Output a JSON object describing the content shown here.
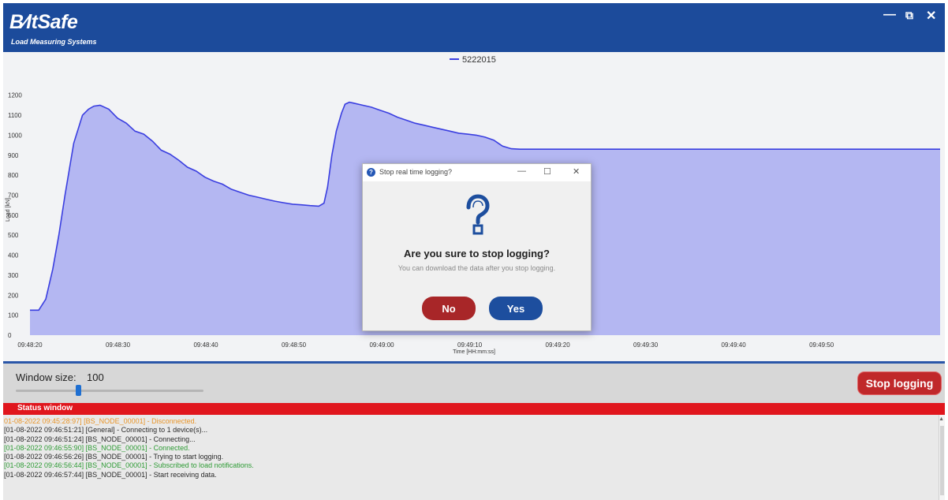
{
  "app": {
    "logo": "B∕ltSafe",
    "tagline": "Load Measuring Systems",
    "window_controls": {
      "minimize": "—",
      "restore": "⧉",
      "close": "✕"
    }
  },
  "chart_data": {
    "type": "area",
    "legend": "5222015",
    "xlabel": "Time [HH:mm:ss]",
    "ylabel": "Load [kN]",
    "ylim": [
      0,
      1250
    ],
    "yticks": [
      0,
      100,
      200,
      300,
      400,
      500,
      600,
      700,
      800,
      900,
      1000,
      1100,
      1200
    ],
    "x_tick_labels": [
      "09:48:20",
      "09:48:30",
      "09:48:40",
      "09:48:50",
      "09:49:00",
      "09:49:10",
      "09:49:20",
      "09:49:30",
      "09:49:40",
      "09:49:50"
    ],
    "x_start_label": "09:48:20",
    "series_color": "#3a3ee0",
    "fill_color": "#b4b7f2",
    "series": [
      {
        "name": "5222015",
        "x": [
          0,
          1,
          1.8,
          2.6,
          3.3,
          4,
          5,
          6,
          6.7,
          7.3,
          8,
          9,
          10,
          11,
          12,
          13,
          14,
          15,
          16,
          17,
          18,
          19,
          20,
          21,
          22,
          23,
          24,
          25,
          26,
          27,
          28,
          29,
          30,
          31,
          32,
          33,
          33.6,
          34,
          34.5,
          35,
          35.6,
          36,
          36.5,
          37,
          38,
          39,
          40,
          41,
          42,
          43,
          44,
          45,
          46,
          47,
          48,
          49,
          50,
          51,
          52,
          53,
          54,
          55,
          56,
          57,
          58,
          59,
          60,
          62,
          64,
          66,
          68,
          70,
          72,
          74,
          76,
          78,
          80,
          82,
          84,
          86,
          88,
          90,
          92,
          94,
          96,
          98,
          100,
          102,
          104
        ],
        "y": [
          125,
          125,
          180,
          330,
          500,
          700,
          960,
          1100,
          1130,
          1145,
          1150,
          1130,
          1085,
          1060,
          1020,
          1005,
          970,
          925,
          905,
          875,
          840,
          820,
          790,
          770,
          755,
          730,
          715,
          700,
          690,
          680,
          670,
          662,
          655,
          652,
          648,
          645,
          660,
          740,
          900,
          1020,
          1110,
          1155,
          1165,
          1160,
          1150,
          1140,
          1125,
          1110,
          1090,
          1075,
          1060,
          1050,
          1040,
          1030,
          1020,
          1010,
          1005,
          1000,
          990,
          975,
          945,
          932,
          930,
          930,
          930,
          930,
          930,
          930,
          930,
          930,
          930,
          930,
          930,
          930,
          930,
          930,
          930,
          930,
          930,
          930,
          930,
          930,
          930,
          930,
          930,
          930,
          930,
          930,
          930
        ]
      }
    ]
  },
  "controls": {
    "window_size_label": "Window size:",
    "window_size_value": "100",
    "stop_button": "Stop logging"
  },
  "status": {
    "title": "Status window",
    "lines": [
      {
        "text": "01-08-2022 09:45:28:97] [BS_NODE_00001] - Disconnected.",
        "color": "#e8952a"
      },
      {
        "text": "[01-08-2022 09:46:51:21] [General] - Connecting to 1 device(s)...",
        "color": "#2a2a2a"
      },
      {
        "text": "[01-08-2022 09:46:51:24] [BS_NODE_00001] - Connecting...",
        "color": "#2a2a2a"
      },
      {
        "text": "[01-08-2022 09:46:55:90] [BS_NODE_00001] - Connected.",
        "color": "#2e9b35"
      },
      {
        "text": "[01-08-2022 09:46:56:26] [BS_NODE_00001] - Trying to start logging.",
        "color": "#2a2a2a"
      },
      {
        "text": "[01-08-2022 09:46:56:44] [BS_NODE_00001] - Subscribed to load notifications.",
        "color": "#2e9b35"
      },
      {
        "text": "[01-08-2022 09:46:57:44] [BS_NODE_00001] - Start receiving data.",
        "color": "#2a2a2a"
      }
    ]
  },
  "dialog": {
    "title": "Stop real time logging?",
    "controls": {
      "minimize": "—",
      "maximize": "☐",
      "close": "✕"
    },
    "icon": "question-icon",
    "message": "Are you sure to stop logging?",
    "submessage": "You can download the data after you stop logging.",
    "no_label": "No",
    "yes_label": "Yes"
  }
}
